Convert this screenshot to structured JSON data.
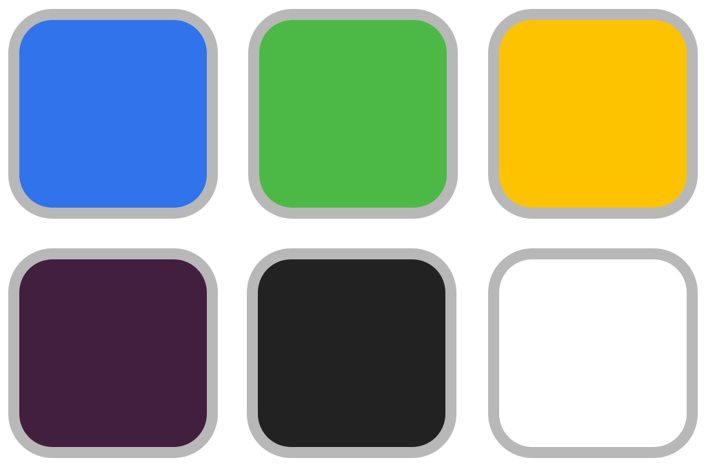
{
  "swatches": [
    {
      "name": "blue",
      "color": "#3073ea"
    },
    {
      "name": "green",
      "color": "#4cb946"
    },
    {
      "name": "yellow",
      "color": "#fdc300"
    },
    {
      "name": "dark-purple",
      "color": "#421f3f"
    },
    {
      "name": "black",
      "color": "#222222"
    },
    {
      "name": "white",
      "color": "#ffffff"
    }
  ],
  "border_color": "#b8b8b8"
}
